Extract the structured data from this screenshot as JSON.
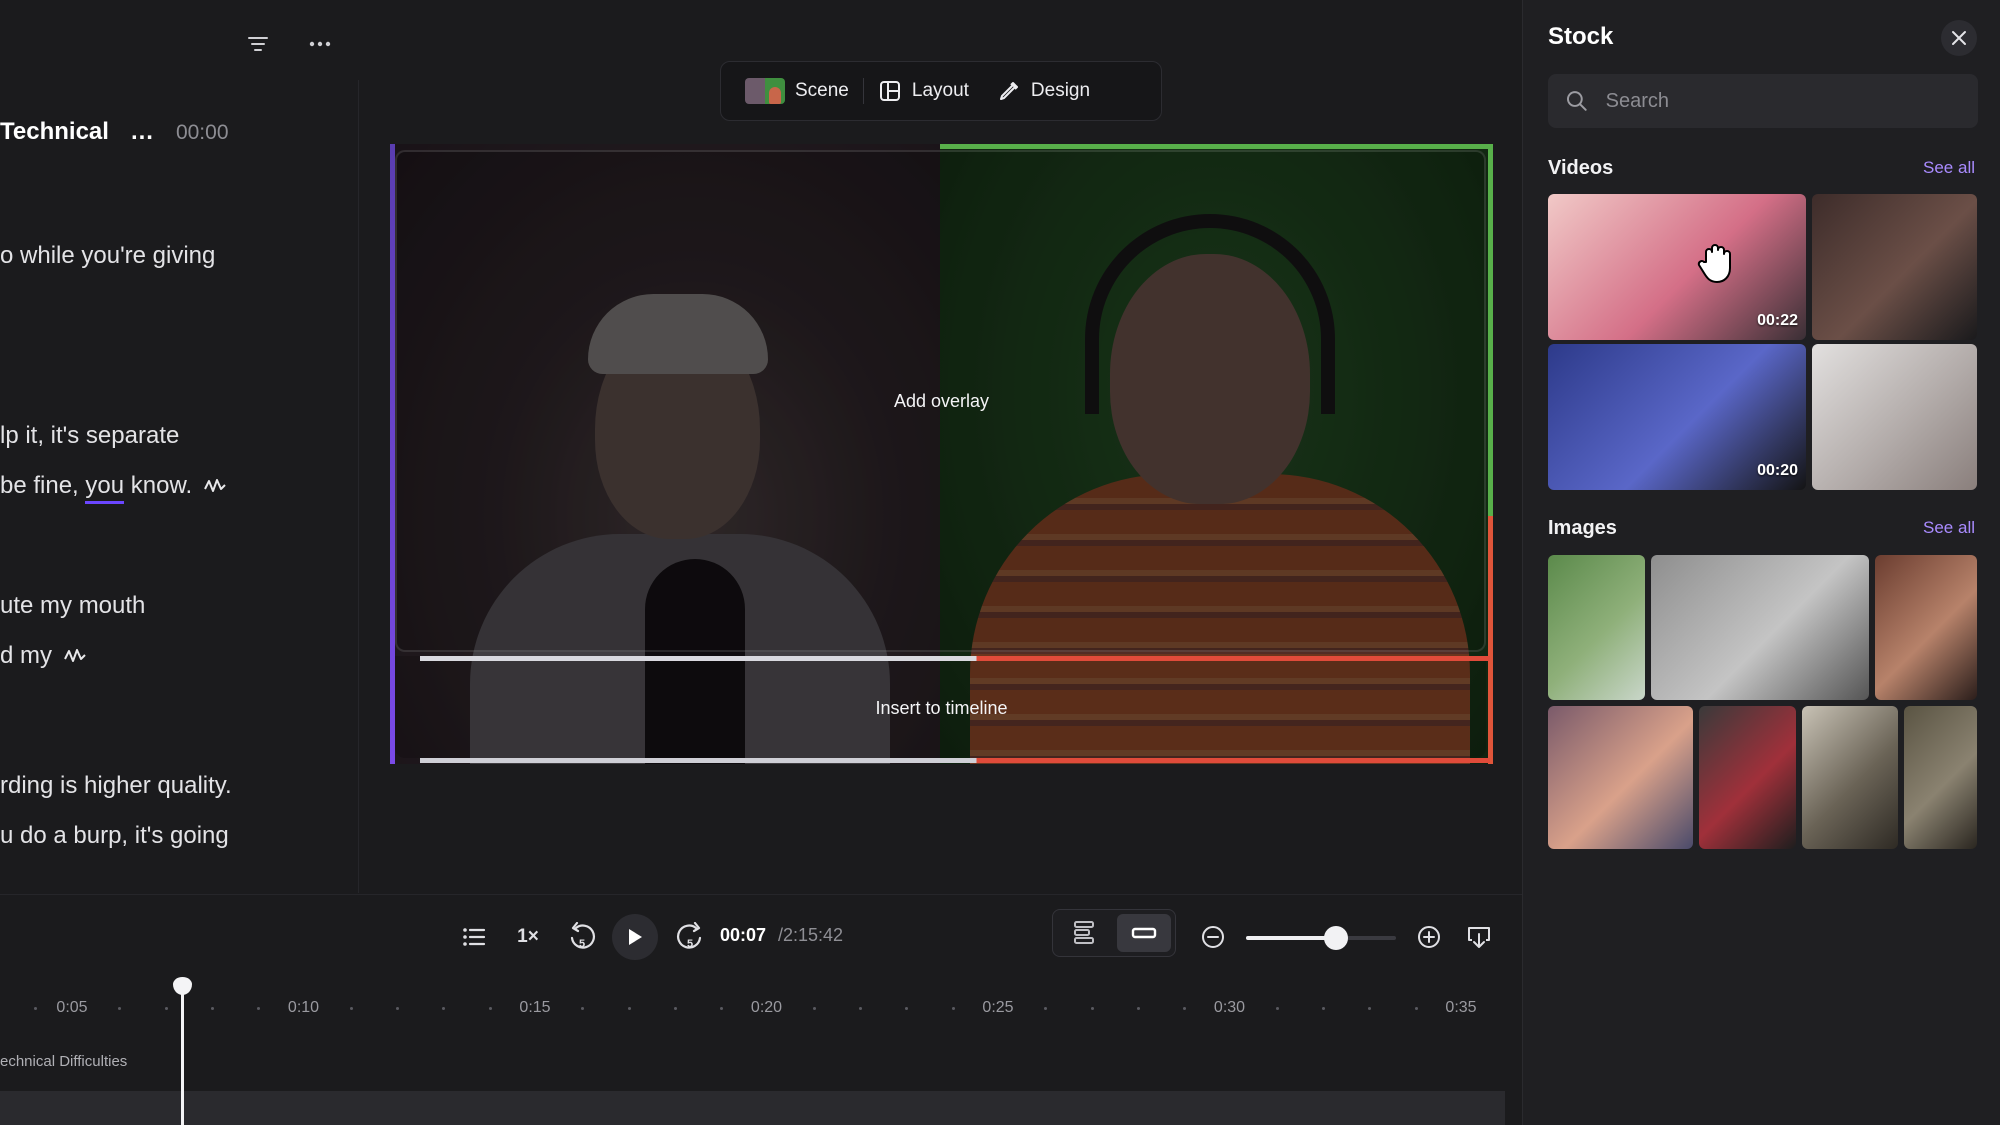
{
  "script": {
    "title": "Technical",
    "more": "...",
    "timestamp": "00:00",
    "lines": [
      {
        "text": "o while you're giving"
      },
      {
        "text": "lp it, it's separate"
      },
      {
        "pre": "be fine, ",
        "highlight": "you",
        "post": " know."
      },
      {
        "text": "ute my mouth"
      },
      {
        "text": "d my"
      },
      {
        "text": "rding is higher quality."
      },
      {
        "text": "u do a burp, it's going"
      }
    ]
  },
  "view_tabs": {
    "scene": "Scene",
    "layout": "Layout",
    "design": "Design"
  },
  "stage": {
    "add_overlay": "Add overlay",
    "insert_timeline": "Insert to timeline"
  },
  "player": {
    "speed": "1×",
    "current_time": "00:07",
    "total_time": "/2:15:42",
    "zoom_level": 0.6
  },
  "timeline": {
    "ticks": [
      "0:05",
      "0:10",
      "0:15",
      "0:20",
      "0:25",
      "0:30",
      "0:35"
    ],
    "track_label": "echnical Difficulties"
  },
  "stock": {
    "title": "Stock",
    "search_placeholder": "Search",
    "videos_title": "Videos",
    "videos_see_all": "See all",
    "images_title": "Images",
    "images_see_all": "See all",
    "videos": [
      {
        "duration": "00:22",
        "colors": [
          "#f1c9c7",
          "#d46f87",
          "#3a2f35"
        ]
      },
      {
        "duration": "",
        "colors": [
          "#3d2c2a",
          "#6b4f47",
          "#1a1a1c"
        ]
      },
      {
        "duration": "00:20",
        "colors": [
          "#2d3a8a",
          "#5a67c8",
          "#141414"
        ]
      },
      {
        "duration": "",
        "colors": [
          "#e2e0df",
          "#b3acaa",
          "#8a7f7c"
        ]
      }
    ],
    "images": [
      {
        "colors": [
          "#5b8a4b",
          "#8fb07a",
          "#c9d6c9"
        ]
      },
      {
        "colors": [
          "#8e8e8e",
          "#c4c4c4",
          "#555555"
        ]
      },
      {
        "colors": [
          "#6b3d30",
          "#b7826a",
          "#2b1e1b"
        ]
      },
      {
        "colors": [
          "#7a5a6a",
          "#d9a18a",
          "#4a4a6a"
        ]
      },
      {
        "colors": [
          "#3a3a3a",
          "#a0303a",
          "#1e1e1e"
        ]
      },
      {
        "colors": [
          "#c8c2b5",
          "#6a6356",
          "#2e2a24"
        ]
      },
      {
        "colors": [
          "#5a5443",
          "#8a8270",
          "#2a2620"
        ]
      }
    ]
  },
  "colors": {
    "accent": "#a98bff",
    "underline": "#6b46ff",
    "green_zone": "#58b04a",
    "red_zone": "#e04b3a"
  }
}
